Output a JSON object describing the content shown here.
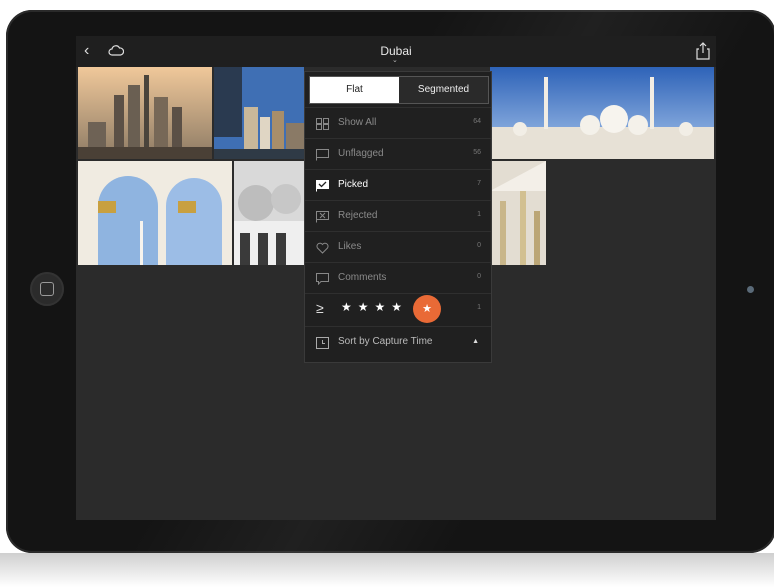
{
  "topbar": {
    "title": "Dubai",
    "title_chevron": "⌄",
    "back_glyph": "‹",
    "icons": [
      "back-icon",
      "cloud-icon",
      "share-icon"
    ]
  },
  "filter_menu": {
    "segments": [
      {
        "label": "Flat",
        "selected": true
      },
      {
        "label": "Segmented",
        "selected": false
      }
    ],
    "items": [
      {
        "label": "Show All",
        "count": "64",
        "icon": "grid-icon",
        "highlight": false
      },
      {
        "label": "Unflagged",
        "count": "56",
        "icon": "unflagged-icon",
        "highlight": false
      },
      {
        "label": "Picked",
        "count": "7",
        "icon": "picked-flag-icon",
        "highlight": true
      },
      {
        "label": "Rejected",
        "count": "1",
        "icon": "rejected-flag-icon",
        "highlight": false
      },
      {
        "label": "Likes",
        "count": "0",
        "icon": "heart-icon",
        "highlight": false
      },
      {
        "label": "Comments",
        "count": "0",
        "icon": "comment-icon",
        "highlight": false
      }
    ],
    "rating": {
      "operator": "≥",
      "stars": [
        "★",
        "★",
        "★",
        "★"
      ],
      "selected_star": "★",
      "value": 5,
      "count": "1"
    },
    "sort": {
      "label": "Sort by Capture Time",
      "caret": "▲",
      "icon": "clock-icon"
    }
  },
  "colors": {
    "accent": "#e96a36",
    "screen_bg": "#2b2b2b",
    "topbar_bg": "#1f1f1f"
  }
}
